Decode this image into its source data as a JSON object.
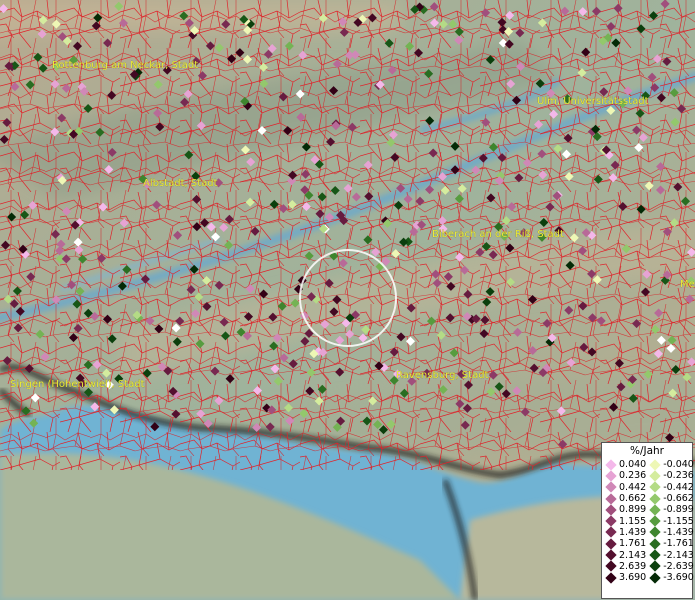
{
  "places": [
    {
      "name": "Rottenburg am Neckar, Stadt"
    },
    {
      "name": "Ulm, Universitätsstadt"
    },
    {
      "name": "Albstadt, Stadt"
    },
    {
      "name": "Biberach an der Riß, Stadt"
    },
    {
      "name": "Singen (Hohentwiel), Stadt"
    },
    {
      "name": "Ravensburg, Stadt"
    },
    {
      "name": "Me"
    }
  ],
  "legend": {
    "title": "%/Jahr",
    "positive": [
      {
        "label": "0.040",
        "color": "#f4b8ea"
      },
      {
        "label": "0.236",
        "color": "#e6a3d4"
      },
      {
        "label": "0.442",
        "color": "#d088b7"
      },
      {
        "label": "0.662",
        "color": "#b86a98"
      },
      {
        "label": "0.899",
        "color": "#a14f7d"
      },
      {
        "label": "1.155",
        "color": "#8c3a66"
      },
      {
        "label": "1.439",
        "color": "#782951"
      },
      {
        "label": "1.761",
        "color": "#661b3f"
      },
      {
        "label": "2.143",
        "color": "#54102f"
      },
      {
        "label": "2.639",
        "color": "#430822"
      },
      {
        "label": "3.690",
        "color": "#320116"
      }
    ],
    "negative": [
      {
        "label": "-0.040",
        "color": "#eef7b5"
      },
      {
        "label": "-0.236",
        "color": "#d4ec9e"
      },
      {
        "label": "-0.442",
        "color": "#b4db86"
      },
      {
        "label": "-0.662",
        "color": "#93c86c"
      },
      {
        "label": "-0.899",
        "color": "#74b354"
      },
      {
        "label": "-1.155",
        "color": "#579c3f"
      },
      {
        "label": "-1.439",
        "color": "#3e852e"
      },
      {
        "label": "-1.761",
        "color": "#296d21"
      },
      {
        "label": "-2.143",
        "color": "#175616"
      },
      {
        "label": "-2.639",
        "color": "#0b3f0d"
      },
      {
        "label": "-3.690",
        "color": "#042a06"
      }
    ]
  }
}
